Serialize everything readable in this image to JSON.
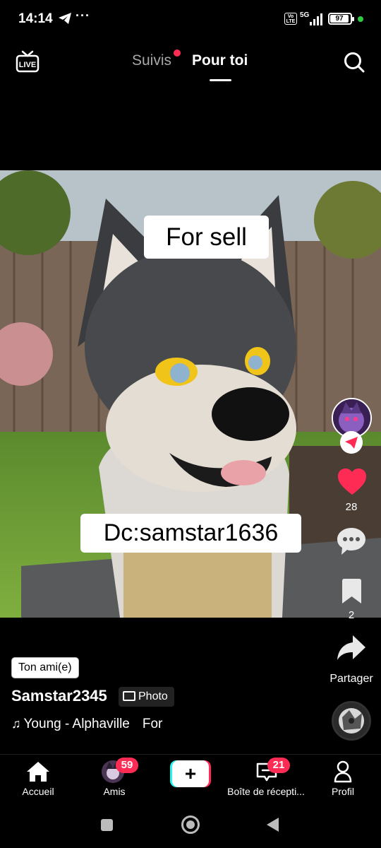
{
  "status_bar": {
    "time": "14:14",
    "more": "···",
    "volte": "Vo LTE",
    "network": "5G",
    "battery": "97"
  },
  "header": {
    "live_label": "LIVE",
    "tab_following": "Suivis",
    "tab_foryou": "Pour toi"
  },
  "post": {
    "overlay_text_1": "For sell",
    "overlay_text_2": "Dc:samstar1636",
    "friend_badge": "Ton ami(e)",
    "username": "Samstar2345",
    "type_pill": "Photo",
    "music": "Young - Alphaville",
    "music_extra": "For"
  },
  "actions": {
    "likes": "28",
    "bookmarks": "2",
    "share_label": "Partager"
  },
  "nav": {
    "home": "Accueil",
    "friends": "Amis",
    "friends_badge": "59",
    "plus": "+",
    "inbox": "Boîte de récepti...",
    "inbox_badge": "21",
    "profile": "Profil"
  },
  "colors": {
    "accent": "#fe2c55",
    "plus_left": "#25f4ee",
    "plus_right": "#fe2c55"
  }
}
